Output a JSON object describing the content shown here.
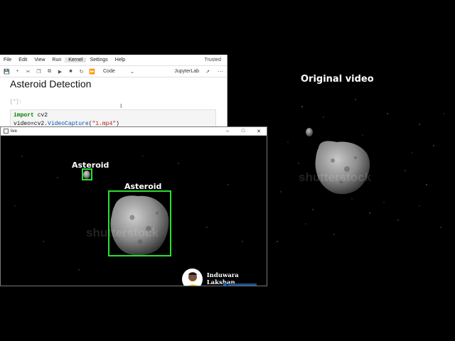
{
  "jupyter": {
    "menu": [
      "File",
      "Edit",
      "View",
      "Run",
      "Kernel",
      "Settings",
      "Help"
    ],
    "active_menu": "Kernel",
    "trusted": "Trusted",
    "toolbar_icons": [
      "save-icon",
      "add-cell-icon",
      "cut-icon",
      "copy-icon",
      "paste-icon",
      "run-icon",
      "stop-icon",
      "restart-icon",
      "fast-forward-icon"
    ],
    "cell_type": "Code",
    "kernel_name": "JupyterLab",
    "notebook_title": "Asteroid Detection",
    "prompt": "[*]:",
    "code": {
      "line1_kw": "import",
      "line1_rest": " cv2",
      "line2_pre": "video=cv2.",
      "line2_fn": "VideoCapture",
      "line2_open": "(",
      "line2_str": "\"1.mp4\"",
      "line2_close": ")"
    }
  },
  "live_window": {
    "title": "live",
    "detections": [
      {
        "label": "Asteroid"
      },
      {
        "label": "Asteroid"
      }
    ],
    "box_color": "#29e034",
    "watermark": "shutterstock",
    "creator": {
      "name": "Induwara Lakshan"
    }
  },
  "original": {
    "title": "Original video",
    "watermark": "shutterstock"
  },
  "colors": {
    "background": "#000000",
    "detection": "#29e034"
  }
}
